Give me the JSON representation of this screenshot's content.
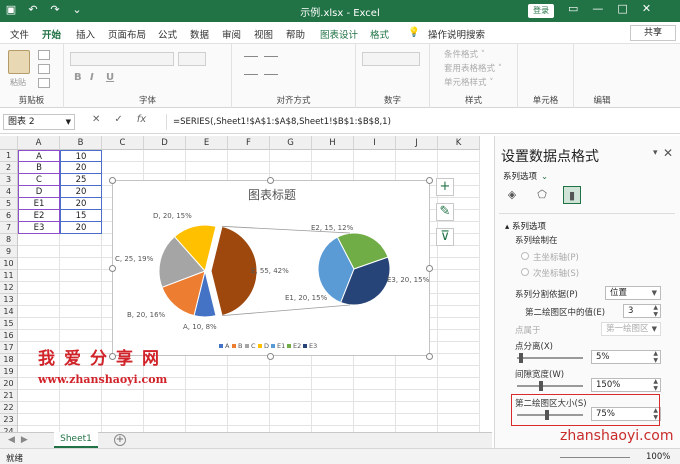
{
  "titlebar": {
    "title": "示例.xlsx - Excel",
    "login": "登录",
    "qat": [
      "save-icon",
      "undo-icon",
      "redo-icon",
      "customize-icon"
    ],
    "min": "—",
    "restore": "□",
    "close": "✕",
    "ribbon_opts": "▭"
  },
  "tabs": {
    "file": "文件",
    "home": "开始",
    "insert": "插入",
    "page_layout": "页面布局",
    "formulas": "公式",
    "data": "数据",
    "review": "审阅",
    "view": "视图",
    "help": "帮助",
    "chart_design": "图表设计",
    "format": "格式",
    "tellme": "操作说明搜索",
    "share": "共享"
  },
  "ribbon": {
    "paste": "粘贴",
    "clipboard": "剪贴板",
    "font": "字体",
    "alignment": "对齐方式",
    "number": "数字",
    "styles": "样式",
    "cells": "单元格",
    "editing": "编辑",
    "cond_format": "条件格式 ˅",
    "table_format": "套用表格格式 ˅",
    "cell_styles": "单元格样式 ˅",
    "bold": "B",
    "italic": "I",
    "underline": "U"
  },
  "formula_bar": {
    "namebox": "图表 2",
    "cancel": "✕",
    "enter": "✓",
    "fx": "fx",
    "formula": "=SERIES(,Sheet1!$A$1:$A$8,Sheet1!$B$1:$B$8,1)"
  },
  "grid": {
    "columns": [
      "A",
      "B",
      "C",
      "D",
      "E",
      "F",
      "G",
      "H",
      "I",
      "J",
      "K"
    ],
    "rows": [
      "1",
      "2",
      "3",
      "4",
      "5",
      "6",
      "7",
      "8",
      "9",
      "10",
      "11",
      "12",
      "13",
      "14",
      "15",
      "16",
      "17",
      "18",
      "19",
      "20",
      "21",
      "22",
      "23",
      "24"
    ],
    "data": [
      [
        "A",
        "10"
      ],
      [
        "B",
        "20"
      ],
      [
        "C",
        "25"
      ],
      [
        "D",
        "20"
      ],
      [
        "E1",
        "20"
      ],
      [
        "E2",
        "15"
      ],
      [
        "E3",
        "20"
      ]
    ]
  },
  "chart_data": {
    "type": "pie",
    "title": "图表标题",
    "legend_position": "bottom",
    "categories": [
      "A",
      "B",
      "C",
      "D",
      "E1",
      "E2",
      "E3"
    ],
    "values": [
      10,
      20,
      25,
      20,
      20,
      15,
      20
    ],
    "main_pie": [
      {
        "name": "A",
        "value": 10,
        "pct": "8%",
        "label": "A, 10, 8%",
        "color": "#4472C4"
      },
      {
        "name": "B",
        "value": 20,
        "pct": "16%",
        "label": "B, 20, 16%",
        "color": "#ED7D31"
      },
      {
        "name": "C",
        "value": 25,
        "pct": "19%",
        "label": "C, 25, 19%",
        "color": "#A5A5A5"
      },
      {
        "name": "D",
        "value": 20,
        "pct": "15%",
        "label": "D, 20, 15%",
        "color": "#FFC000"
      },
      {
        "name": "E",
        "value": 55,
        "pct": "42%",
        "label": "E, 55, 42%",
        "color": "#9E480E"
      }
    ],
    "secondary_pie": [
      {
        "name": "E1",
        "value": 20,
        "pct": "15%",
        "label": "E1, 20, 15%",
        "color": "#5B9BD5"
      },
      {
        "name": "E2",
        "value": 15,
        "pct": "12%",
        "label": "E2, 15, 12%",
        "color": "#70AD47"
      },
      {
        "name": "E3",
        "value": 20,
        "pct": "15%",
        "label": "E3, 20, 15%",
        "color": "#264478"
      }
    ],
    "legend": [
      "A",
      "B",
      "C",
      "D",
      "E1",
      "E2",
      "E3"
    ]
  },
  "watermark": {
    "line1": "我爱分享网",
    "line2": "www.zhanshaoyi.com",
    "line3": "zhanshaoyi.com"
  },
  "sheets": {
    "active": "Sheet1",
    "add": "+"
  },
  "status": {
    "ready": "就绪",
    "zoom": "100%"
  },
  "pane": {
    "title": "设置数据点格式",
    "subtitle": "系列选项",
    "section": "系列选项",
    "plot_on": "系列绘制在",
    "primary_axis": "主坐标轴(P)",
    "secondary_axis": "次坐标轴(S)",
    "split_by_label": "系列分割依据(P)",
    "split_by_value": "位置",
    "values_in_second": "第二绘图区中的值(E)",
    "values_in_second_val": "3",
    "point_belongs": "点属于",
    "point_belongs_val": "第一绘图区",
    "explosion": "点分离(X)",
    "explosion_val": "5%",
    "gap_width": "间隙宽度(W)",
    "gap_width_val": "150%",
    "second_size": "第二绘图区大小(S)",
    "second_size_val": "75%",
    "accent": "#217346",
    "highlight": "#d82c2c"
  }
}
